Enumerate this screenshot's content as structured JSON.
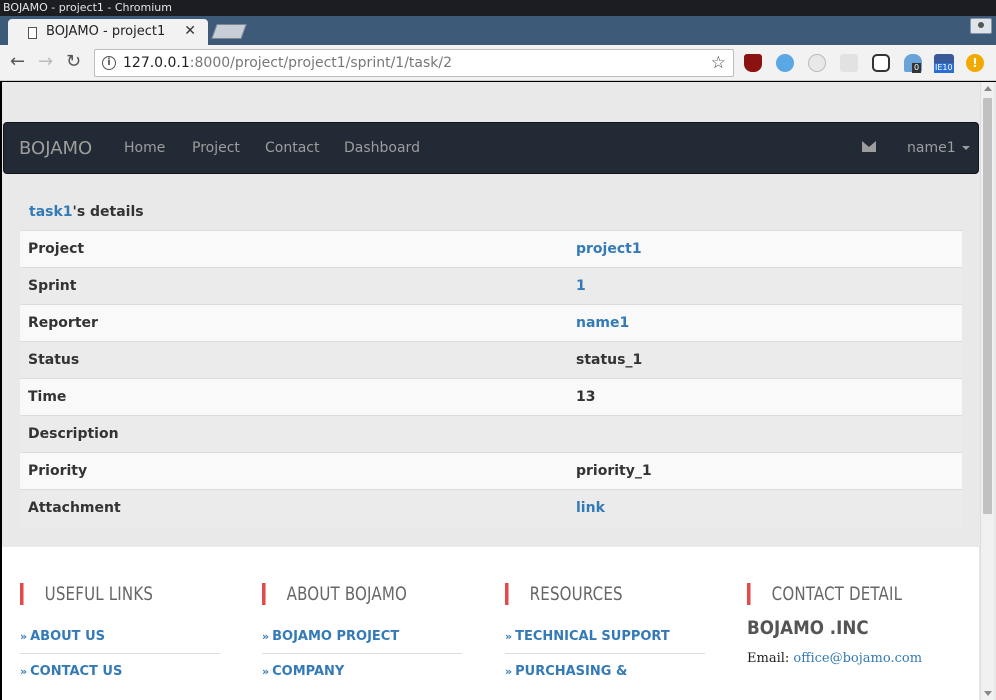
{
  "window": {
    "title": "BOJAMO - project1 - Chromium"
  },
  "tab": {
    "title": "BOJAMO - project1"
  },
  "toolbar": {
    "url_host": "127.0.0.1",
    "url_rest": ":8000/project/project1/sprint/1/task/2",
    "extension_badges": [
      "0",
      "IE10"
    ]
  },
  "navbar": {
    "brand": "BOJAMO",
    "links": [
      "Home",
      "Project",
      "Contact",
      "Dashboard"
    ],
    "user": "name1"
  },
  "details": {
    "task_link": "task1",
    "heading_suffix": "'s details",
    "rows": [
      {
        "label": "Project",
        "value": "project1",
        "is_link": true
      },
      {
        "label": "Sprint",
        "value": "1",
        "is_link": true
      },
      {
        "label": "Reporter",
        "value": "name1",
        "is_link": true
      },
      {
        "label": "Status",
        "value": "status_1",
        "is_link": false
      },
      {
        "label": "Time",
        "value": "13",
        "is_link": false
      },
      {
        "label": "Description",
        "value": "",
        "is_link": false
      },
      {
        "label": "Priority",
        "value": "priority_1",
        "is_link": false
      },
      {
        "label": "Attachment",
        "value": "link",
        "is_link": true
      }
    ]
  },
  "footer": {
    "useful_links": {
      "title": "USEFUL LINKS",
      "items": [
        "ABOUT US",
        "CONTACT US"
      ]
    },
    "about": {
      "title": "ABOUT BOJAMO",
      "items": [
        "BOJAMO PROJECT",
        "COMPANY"
      ]
    },
    "resources": {
      "title": "RESOURCES",
      "items": [
        "TECHNICAL SUPPORT",
        "PURCHASING & LICENSING"
      ]
    },
    "contact": {
      "title": "CONTACT DETAIL",
      "company": "BOJAMO .INC",
      "email_label": "Email:",
      "email": "office@bojamo.com"
    }
  },
  "colors": {
    "accent": "#337ab7",
    "navbar": "#222b35",
    "footer_bar": "#e14b4b"
  }
}
